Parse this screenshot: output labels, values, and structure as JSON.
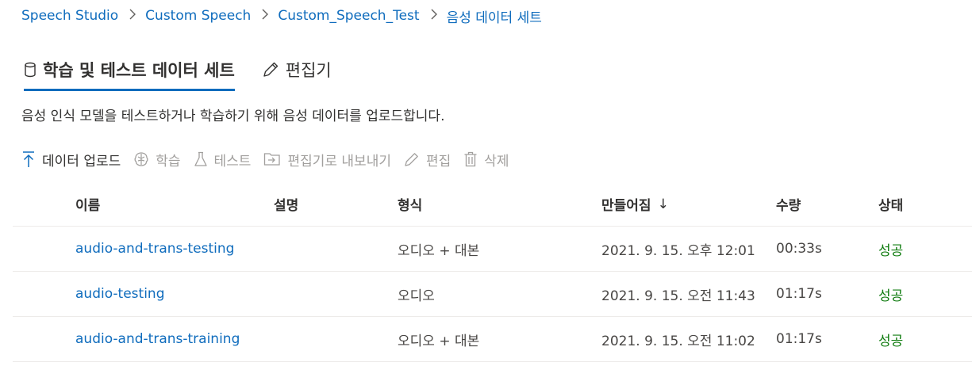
{
  "breadcrumb": {
    "items": [
      "Speech Studio",
      "Custom Speech",
      "Custom_Speech_Test",
      "음성 데이터 세트"
    ]
  },
  "tabs": [
    {
      "label": "학습 및 테스트 데이터 세트",
      "icon": "database-icon",
      "active": true
    },
    {
      "label": "편집기",
      "icon": "pencil-icon",
      "active": false
    }
  ],
  "description": "음성 인식 모델을 테스트하거나 학습하기 위해 음성 데이터를 업로드합니다.",
  "toolbar": {
    "upload": "데이터 업로드",
    "train": "학습",
    "test": "테스트",
    "export": "편집기로 내보내기",
    "edit": "편집",
    "delete": "삭제"
  },
  "table": {
    "columns": {
      "name": "이름",
      "description": "설명",
      "format": "형식",
      "created": "만들어짐",
      "created_sort": "↓",
      "quantity": "수량",
      "status": "상태"
    },
    "rows": [
      {
        "name": "audio-and-trans-testing",
        "description": "",
        "format": "오디오 + 대본",
        "created": "2021. 9. 15. 오후 12:01",
        "quantity": "00:33s",
        "status": "성공"
      },
      {
        "name": "audio-testing",
        "description": "",
        "format": "오디오",
        "created": "2021. 9. 15. 오전 11:43",
        "quantity": "01:17s",
        "status": "성공"
      },
      {
        "name": "audio-and-trans-training",
        "description": "",
        "format": "오디오 + 대본",
        "created": "2021. 9. 15. 오전 11:02",
        "quantity": "01:17s",
        "status": "성공"
      }
    ]
  },
  "colors": {
    "accent": "#0f6cbd",
    "success": "#107c10",
    "disabled": "#a19f9d"
  }
}
